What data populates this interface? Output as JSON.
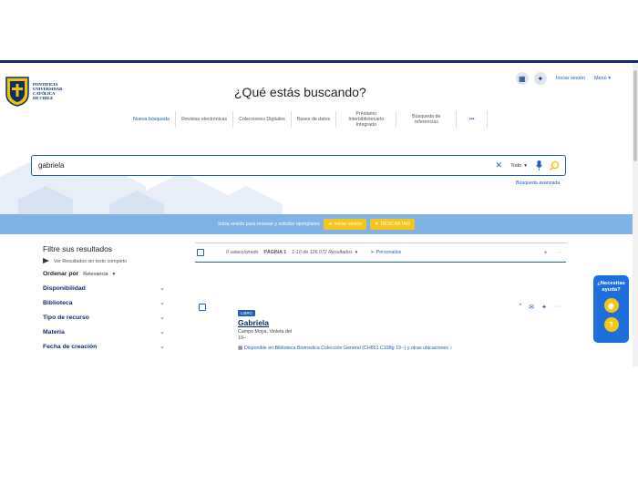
{
  "brand": {
    "logo_text": [
      "Pontificia",
      "Universidad",
      "Católica",
      "de Chile"
    ]
  },
  "header": {
    "title": "¿Qué estás buscando?",
    "signin_label": "Iniciar sesión",
    "menu_label": "Menú"
  },
  "nav": {
    "items": [
      {
        "label": "Nueva búsqueda"
      },
      {
        "label": "Revistas electrónicas"
      },
      {
        "label": "Colecciones Digitales"
      },
      {
        "label": "Bases de datos"
      },
      {
        "label": "Préstamo Interbibliotecario Integrado"
      },
      {
        "label": "Búsqueda de referencias"
      },
      {
        "label": "•••"
      }
    ]
  },
  "search": {
    "value": "gabriela",
    "scope": "Todo",
    "advanced_label": "Búsqueda avanzada"
  },
  "banner": {
    "text": "Inicia sesión para renovar y solicitar ejemplares",
    "signin_label": "Iniciar sesión",
    "dismiss_label": "DESCARTAR"
  },
  "sidebar": {
    "title": "Filtre sus resultados",
    "toggle_label": "Ver Resultados sin texto completo",
    "sort_label": "Ordenar por",
    "sort_value": "Relevancia",
    "facets": [
      {
        "label": "Disponibilidad"
      },
      {
        "label": "Biblioteca"
      },
      {
        "label": "Tipo de recurso"
      },
      {
        "label": "Materia"
      },
      {
        "label": "Fecha de creación"
      }
    ]
  },
  "results": {
    "selected": "0 seleccionado",
    "page_label": "PÁGINA 1",
    "range": "1-10 de 126.072 Resultados",
    "personalize": "Personalice",
    "items": [
      {
        "type": "LIBRO",
        "title": "Gabriela",
        "author_line1": "Campo Moya, Violeta del",
        "author_line2": "19--",
        "availability": "Disponible en Biblioteca Biomédica  Colección General (CH861 C198g 19--) y otras ubicaciones"
      }
    ]
  },
  "help": {
    "label": "¿Necesitas ayuda?"
  },
  "colors": {
    "primary": "#1e5fb4",
    "navy": "#0a2d6e",
    "banner": "#7fb3e8",
    "accent": "#f5c518"
  }
}
